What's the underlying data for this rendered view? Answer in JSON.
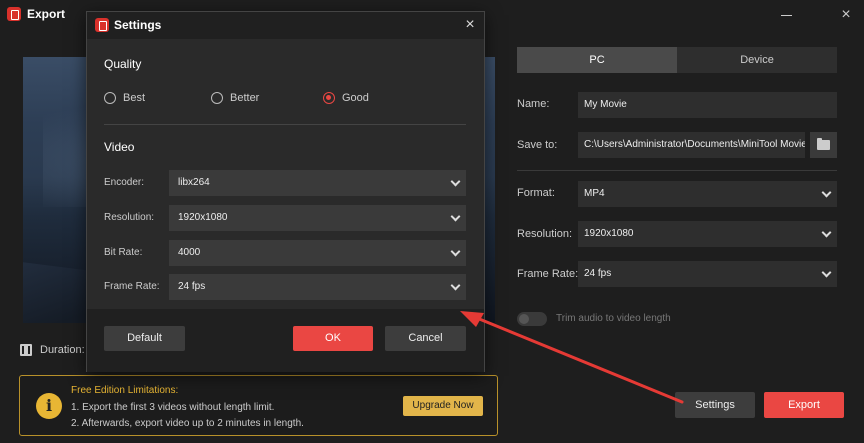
{
  "window": {
    "title": "Export"
  },
  "preview": {
    "duration_label": "Duration:"
  },
  "tabs": [
    {
      "label": "PC"
    },
    {
      "label": "Device"
    }
  ],
  "fields": {
    "name_label": "Name:",
    "name_value": "My Movie",
    "saveto_label": "Save to:",
    "saveto_value": "C:\\Users\\Administrator\\Documents\\MiniTool Movie",
    "format_label": "Format:",
    "format_value": "MP4",
    "resolution_label": "Resolution:",
    "resolution_value": "1920x1080",
    "framerate_label": "Frame Rate:",
    "framerate_value": "24 fps"
  },
  "trim_label": "Trim audio to video length",
  "limits": {
    "title": "Free Edition Limitations:",
    "line1": "1. Export the first 3 videos without length limit.",
    "line2": "2. Afterwards, export video up to 2 minutes in length.",
    "upgrade_label": "Upgrade Now"
  },
  "bottom_buttons": {
    "settings": "Settings",
    "export": "Export"
  },
  "dialog": {
    "title": "Settings",
    "quality_title": "Quality",
    "quality_options": [
      {
        "label": "Best"
      },
      {
        "label": "Better"
      },
      {
        "label": "Good"
      }
    ],
    "quality_selected": "Good",
    "video_title": "Video",
    "encoder_label": "Encoder:",
    "encoder_value": "libx264",
    "resolution_label": "Resolution:",
    "resolution_value": "1920x1080",
    "bitrate_label": "Bit Rate:",
    "bitrate_value": "4000",
    "framerate_label": "Frame Rate:",
    "framerate_value": "24 fps",
    "default_label": "Default",
    "ok_label": "OK",
    "cancel_label": "Cancel"
  },
  "colors": {
    "accent": "#ea4743",
    "warning": "#e8b634",
    "annotation": "#e53a35"
  },
  "icons": {
    "close": "×",
    "info": "i"
  }
}
